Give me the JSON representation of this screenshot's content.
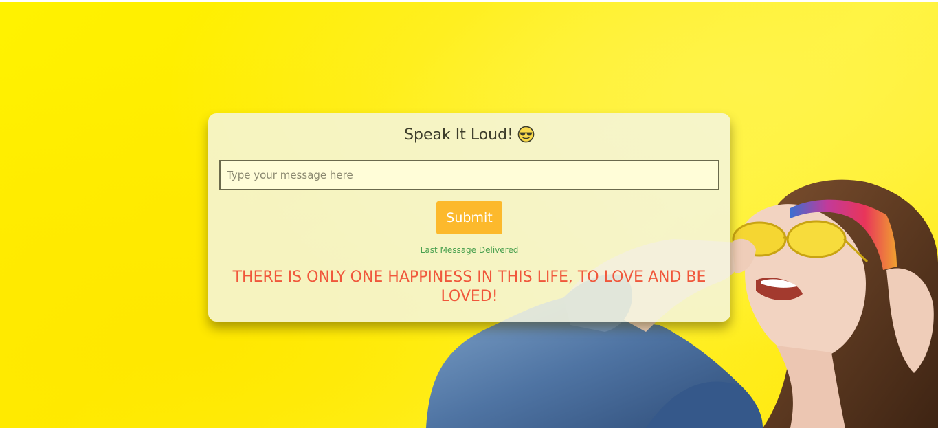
{
  "card": {
    "title": "Speak It Loud!",
    "title_icon": "smiling-face-with-sunglasses-icon",
    "input_placeholder": "Type your message here",
    "input_value": "",
    "submit_label": "Submit",
    "status_text": "Last Message Delivered",
    "last_message": "THERE IS ONLY ONE HAPPINESS IN THIS LIFE, TO LOVE AND BE LOVED!"
  },
  "colors": {
    "background": "#fff200",
    "card_background": "#f5f4de",
    "button": "#fcb92c",
    "status": "#4aa04f",
    "message": "#f0573b"
  }
}
